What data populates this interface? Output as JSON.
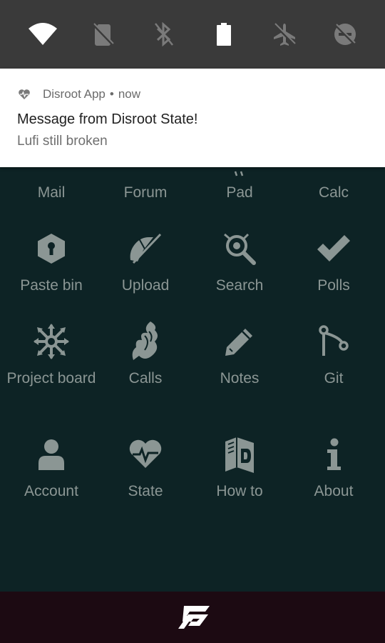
{
  "quick_settings": {
    "tiles": [
      {
        "icon": "wifi-icon",
        "state": "on"
      },
      {
        "icon": "no-sim-icon",
        "state": "off"
      },
      {
        "icon": "bluetooth-off-icon",
        "state": "off"
      },
      {
        "icon": "battery-icon",
        "state": "on"
      },
      {
        "icon": "airplane-mode-icon",
        "state": "off"
      },
      {
        "icon": "do-not-disturb-off-icon",
        "state": "off"
      }
    ]
  },
  "notification": {
    "app_name": "Disroot App",
    "separator": "•",
    "time": "now",
    "title": "Message from Disroot State!",
    "text": "Lufi still broken"
  },
  "apps": {
    "row0": [
      "Mail",
      "Forum",
      "Pad",
      "Calc"
    ],
    "row1": [
      "Paste bin",
      "Upload",
      "Search",
      "Polls"
    ],
    "row2": [
      "Project board",
      "Calls",
      "Notes",
      "Git"
    ],
    "row3": [
      "Account",
      "State",
      "How to",
      "About"
    ]
  },
  "colors": {
    "background": "#0d2325",
    "icon": "#8b9694",
    "bottom_bar": "#1c0a12",
    "quick_settings": "#3a3a3a"
  }
}
